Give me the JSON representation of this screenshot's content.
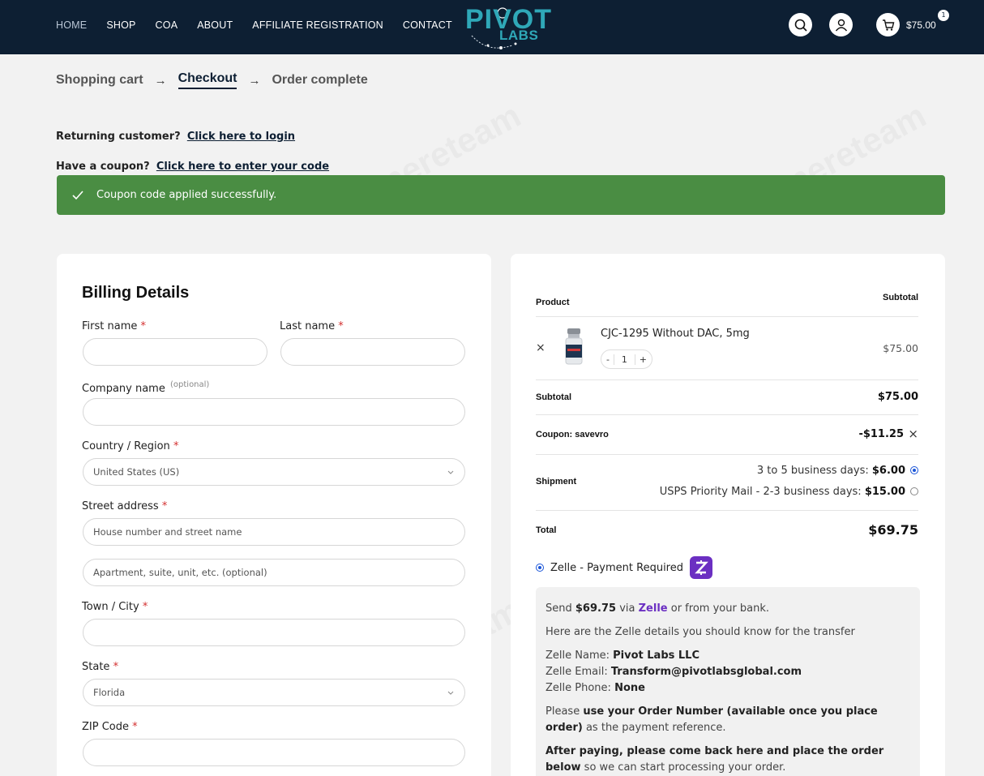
{
  "header": {
    "nav": [
      "HOME",
      "SHOP",
      "COA",
      "ABOUT",
      "AFFILIATE REGISTRATION",
      "CONTACT"
    ],
    "logo_main": "PIVOT",
    "logo_sub": "LABS",
    "cart_total": "$75.00",
    "cart_count": "1"
  },
  "steps": {
    "cart": "Shopping cart",
    "checkout": "Checkout",
    "complete": "Order complete"
  },
  "notices": {
    "returning_label": "Returning customer?",
    "returning_link": "Click here to login",
    "coupon_label": "Have a coupon?",
    "coupon_link": "Click here to enter your code",
    "success": "Coupon code applied successfully."
  },
  "billing": {
    "title": "Billing Details",
    "first_name": "First name",
    "last_name": "Last name",
    "company": "Company name",
    "optional": "(optional)",
    "country": "Country / Region",
    "country_value": "United States (US)",
    "street": "Street address",
    "street_placeholder": "House number and street name",
    "apt_placeholder": "Apartment, suite, unit, etc. (optional)",
    "city": "Town / City",
    "state": "State",
    "state_value": "Florida",
    "zip": "ZIP Code",
    "required_mark": "*"
  },
  "order": {
    "col_product": "Product",
    "col_subtotal": "Subtotal",
    "item_name": "CJC-1295 Without DAC, 5mg",
    "item_qty": "1",
    "item_price": "$75.00",
    "subtotal_label": "Subtotal",
    "subtotal_value": "$75.00",
    "coupon_label": "Coupon: savevro",
    "coupon_value": "-$11.25",
    "shipment_label": "Shipment",
    "ship1_label": "3 to 5 business days:",
    "ship1_price": "$6.00",
    "ship2_label": "USPS Priority Mail - 2-3 business days:",
    "ship2_price": "$15.00",
    "total_label": "Total",
    "total_value": "$69.75",
    "payment_label": "Zelle - Payment Required"
  },
  "zelle": {
    "send_pre": "Send",
    "send_amount": "$69.75",
    "send_via": "via",
    "send_zelle": "Zelle",
    "send_post": "or from your bank.",
    "intro": "Here are the Zelle details you should know for the transfer",
    "name_label": "Zelle Name:",
    "name_value": "Pivot Labs LLC",
    "email_label": "Zelle Email:",
    "email_value": "Transform@pivotlabsglobal.com",
    "phone_label": "Zelle Phone:",
    "phone_value": "None",
    "ref_pre": "Please",
    "ref_bold": "use your Order Number (available once you place order)",
    "ref_post": "as the payment reference.",
    "after_bold": "After paying, please come back here and place the order below",
    "after_post": "so we can start processing your order."
  },
  "watermark": "Tenereteam",
  "colors": {
    "header_bg": "#0d1f33",
    "success_bg": "#4a8d43",
    "zelle_purple": "#6b2fc2",
    "radio_blue": "#1a55d8"
  }
}
